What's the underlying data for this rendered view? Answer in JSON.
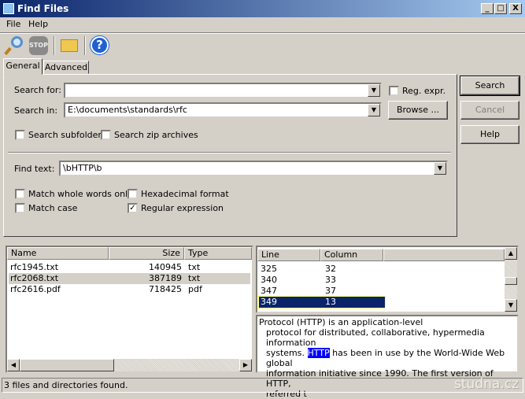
{
  "window": {
    "title": "Find Files",
    "minimize": "_",
    "maximize": "□",
    "close": "X"
  },
  "menu": [
    "File",
    "Help"
  ],
  "toolbar": {
    "find": "search-icon",
    "stop": "STOP",
    "open": "open-folder-icon",
    "help": "?"
  },
  "tabs": [
    "General",
    "Advanced"
  ],
  "general": {
    "search_for_label": "Search for:",
    "search_for_value": "",
    "reg_expr_label": "Reg. expr.",
    "reg_expr_checked": false,
    "search_in_label": "Search in:",
    "search_in_value": "E:\\documents\\standards\\rfc",
    "browse_label": "Browse ...",
    "subfolders_label": "Search subfolders",
    "zip_label": "Search zip archives",
    "find_text_label": "Find text:",
    "find_text_value": "\\bHTTP\\b",
    "whole_words_label": "Match whole words only",
    "hex_label": "Hexadecimal format",
    "match_case_label": "Match case",
    "regex_label": "Regular expression",
    "regex_checked": true
  },
  "buttons": {
    "search": "Search",
    "cancel": "Cancel",
    "help": "Help"
  },
  "files": {
    "columns": [
      "Name",
      "Size",
      "Type"
    ],
    "rows": [
      {
        "name": "rfc1945.txt",
        "size": "140945",
        "type": "txt"
      },
      {
        "name": "rfc2068.txt",
        "size": "387189",
        "type": "txt"
      },
      {
        "name": "rfc2616.pdf",
        "size": "718425",
        "type": "pdf"
      }
    ]
  },
  "matches": {
    "columns": [
      "Line",
      "Column"
    ],
    "rows": [
      {
        "line": "325",
        "col": "32"
      },
      {
        "line": "340",
        "col": "33"
      },
      {
        "line": "347",
        "col": "37"
      },
      {
        "line": "349",
        "col": "13"
      }
    ]
  },
  "preview": {
    "line1": "Protocol (HTTP) is an application-level",
    "line2": "protocol for distributed, collaborative, hypermedia information",
    "line3_pre": "systems. ",
    "line3_hl": "HTTP",
    "line3_post": " has been in use by the World-Wide Web global",
    "line4": "information initiative since 1990. The first version of HTTP,",
    "line5": "referred t"
  },
  "status": "3 files and directories found.",
  "watermark": "studna.cz"
}
